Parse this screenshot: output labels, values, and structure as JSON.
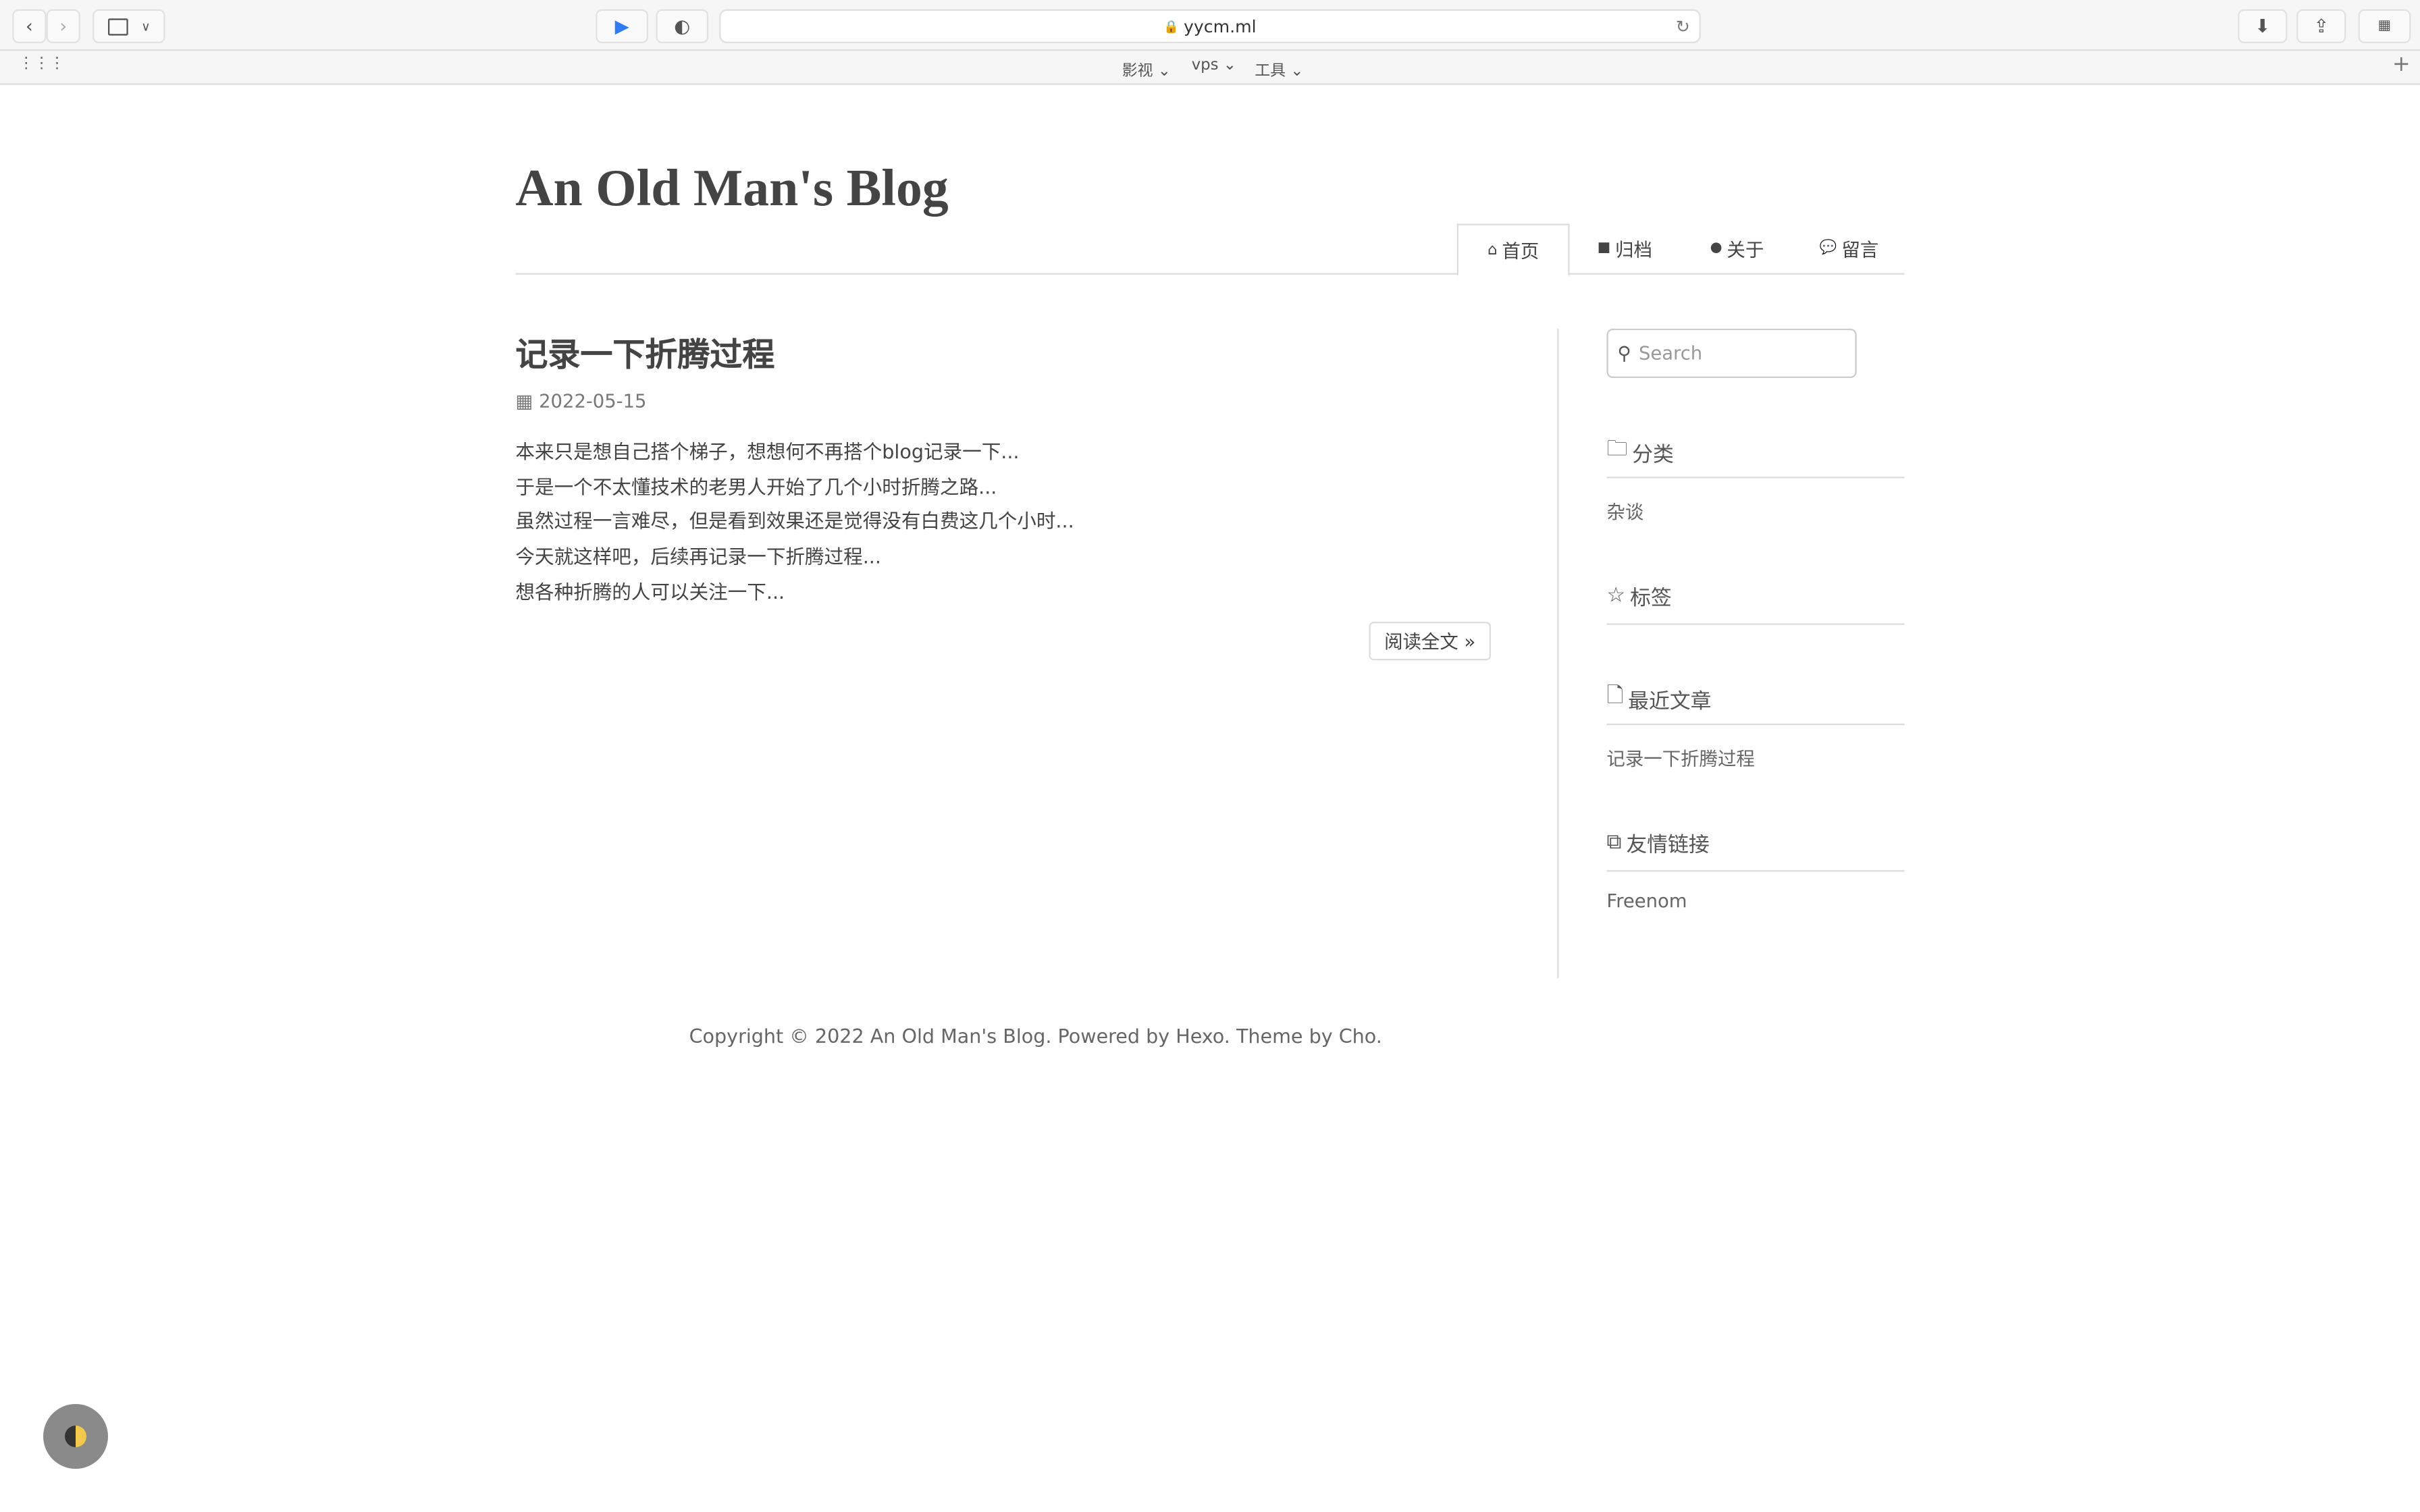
{
  "browser": {
    "url": "yycm.ml",
    "bookmarks": [
      {
        "label": "影视"
      },
      {
        "label": "vps"
      },
      {
        "label": "工具"
      }
    ]
  },
  "blog": {
    "title": "An Old Man's Blog",
    "nav": [
      {
        "label": "首页",
        "icon": "home-icon",
        "active": true
      },
      {
        "label": "归档",
        "icon": "archive-icon"
      },
      {
        "label": "关于",
        "icon": "user-icon"
      },
      {
        "label": "留言",
        "icon": "comments-icon"
      }
    ]
  },
  "post": {
    "title": "记录一下折腾过程",
    "date": "2022-05-15",
    "excerpt": [
      "本来只是想自己搭个梯子，想想何不再搭个blog记录一下...",
      "于是一个不太懂技术的老男人开始了几个小时折腾之路...",
      "虽然过程一言难尽，但是看到效果还是觉得没有白费这几个小时...",
      "今天就这样吧，后续再记录一下折腾过程...",
      "想各种折腾的人可以关注一下..."
    ],
    "read_more": "阅读全文 »"
  },
  "sidebar": {
    "search_placeholder": "Search",
    "categories": {
      "title": "分类",
      "items": [
        "杂谈"
      ]
    },
    "tags": {
      "title": "标签"
    },
    "recent": {
      "title": "最近文章",
      "items": [
        "记录一下折腾过程"
      ]
    },
    "links": {
      "title": "友情链接",
      "items": [
        "Freenom"
      ]
    }
  },
  "footer": "Copyright © 2022 An Old Man's Blog. Powered by Hexo. Theme by Cho."
}
